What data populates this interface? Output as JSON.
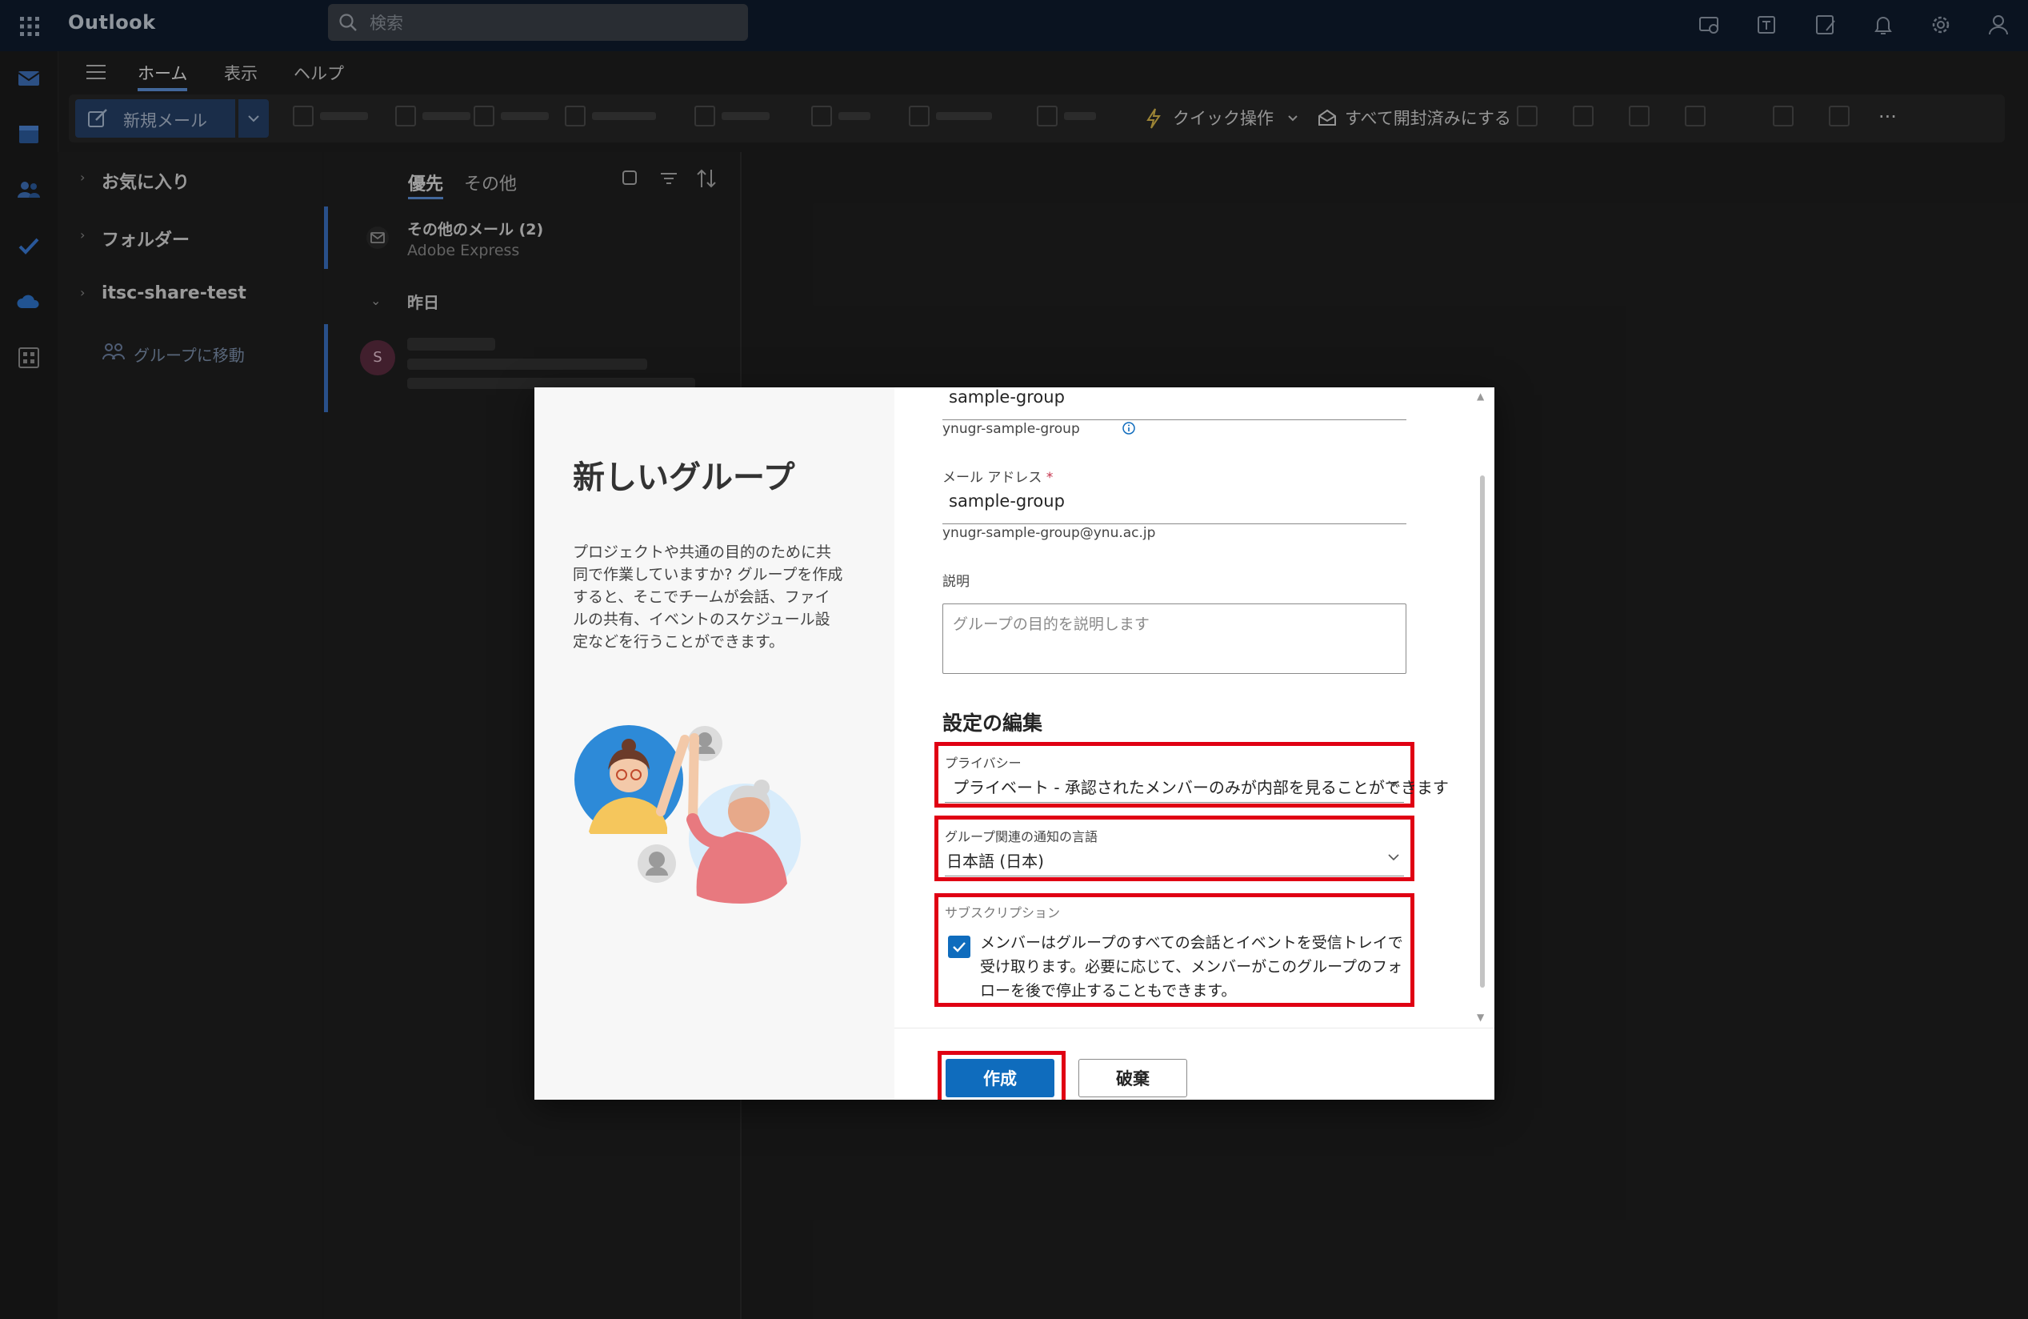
{
  "app": {
    "title": "Outlook"
  },
  "search": {
    "placeholder": "検索"
  },
  "ribbon": {
    "tabs": [
      {
        "label": "ホーム",
        "active": true
      },
      {
        "label": "表示",
        "active": false
      },
      {
        "label": "ヘルプ",
        "active": false
      }
    ],
    "new_mail_label": "新規メール",
    "quick_actions_label": "クイック操作",
    "mark_all_read_label": "すべて開封済みにする"
  },
  "folders": {
    "items": [
      {
        "label": "お気に入り"
      },
      {
        "label": "フォルダー"
      },
      {
        "label": "itsc-share-test"
      }
    ],
    "go_to_groups": "グループに移動"
  },
  "message_list": {
    "pivots": {
      "focused": "優先",
      "other": "その他"
    },
    "other_mail": {
      "title": "その他のメール (2)",
      "sender": "Adobe Express"
    },
    "section_yesterday": "昨日",
    "avatar_initial": "S"
  },
  "dialog": {
    "title": "新しいグループ",
    "description": "プロジェクトや共通の目的のために共同で作業していますか? グループを作成すると、そこでチームが会話、ファイルの共有、イベントのスケジュール設定などを行うことができます。",
    "name_field": {
      "value": "sample-group",
      "helper": "ynugr-sample-group"
    },
    "email_field": {
      "label": "メール アドレス",
      "required_mark": "*",
      "value": "sample-group",
      "helper": "ynugr-sample-group@ynu.ac.jp"
    },
    "description_field": {
      "label": "説明",
      "placeholder": "グループの目的を説明します"
    },
    "settings_heading": "設定の編集",
    "privacy": {
      "label": "プライバシー",
      "value": "プライベート - 承認されたメンバーのみが内部を見ることができます"
    },
    "language": {
      "label": "グループ関連の通知の言語",
      "value": "日本語 (日本)"
    },
    "subscription": {
      "label": "サブスクリプション",
      "checked": true,
      "text": "メンバーはグループのすべての会話とイベントを受信トレイで受け取ります。必要に応じて、メンバーがこのグループのフォローを後で停止することもできます。"
    },
    "buttons": {
      "create": "作成",
      "discard": "破棄"
    }
  },
  "colors": {
    "accent": "#0f6cbd",
    "highlight": "#e00013",
    "topbar": "#0f1b2d"
  }
}
